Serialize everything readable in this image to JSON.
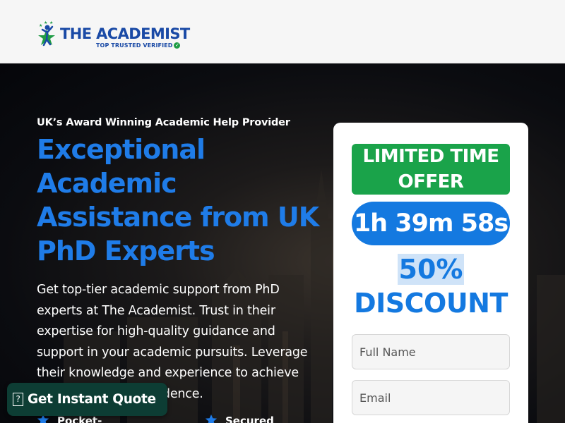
{
  "header": {
    "logo_title": "THE ACADEMIST",
    "logo_subtitle": "TOP TRUSTED VERIFIED",
    "brand_color": "#1a4aa6"
  },
  "hero": {
    "eyebrow": "UK’s Award Winning Academic Help Provider",
    "headline": "Exceptional Academic Assistance from UK PhD Experts",
    "description": "Get top-tier academic support from PhD experts at The Academist. Trust in their expertise for high-quality guidance and support in your academic pursuits. Leverage their knowledge and experience to achieve your goals with confidence.",
    "features": [
      {
        "label": "Pocket-",
        "icon": "star-icon"
      },
      {
        "label": "Secured",
        "icon": "star-icon"
      }
    ],
    "accent_color": "#1f7ce8"
  },
  "quote_button": {
    "label": "Get Instant Quote",
    "icon": "quote-icon",
    "color": "#0d3d34"
  },
  "offer": {
    "banner_line1": "LIMITED TIME",
    "banner_line2": "OFFER",
    "timer": "1h 39m 58s",
    "discount_percent": "50%",
    "discount_word": "DISCOUNT",
    "banner_color": "#1aa34a",
    "timer_color": "#1479e0"
  },
  "form": {
    "name_placeholder": "Full Name",
    "email_placeholder": "Email"
  }
}
